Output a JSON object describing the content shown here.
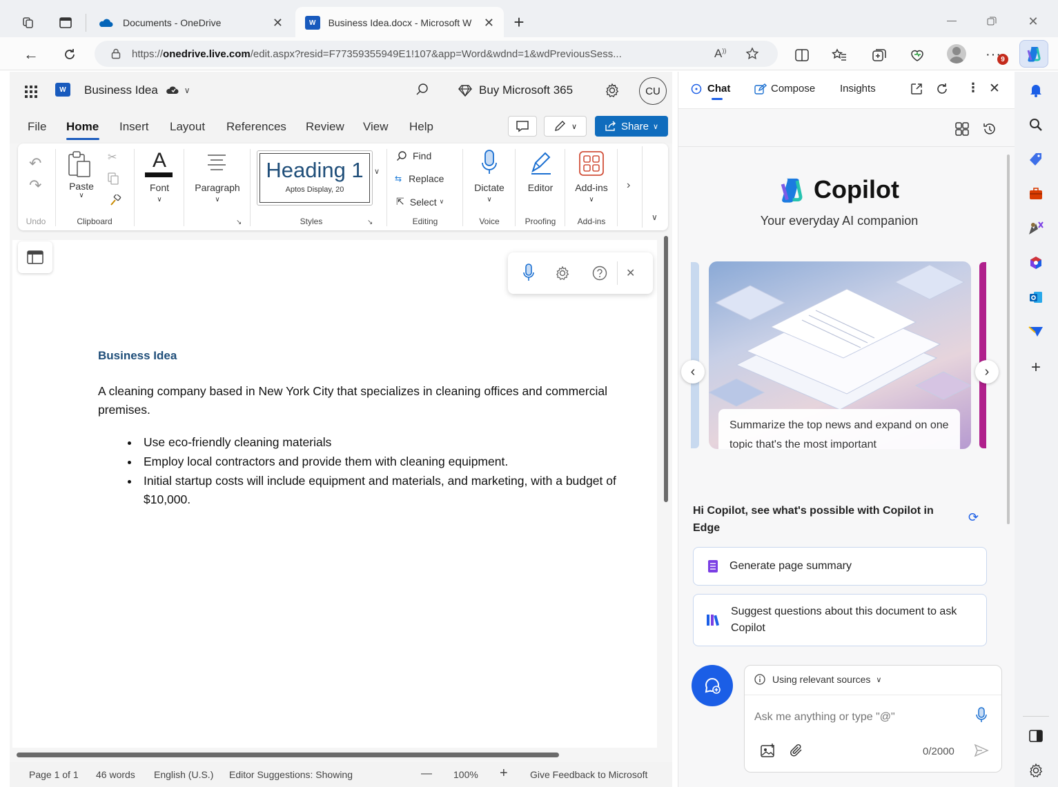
{
  "browser": {
    "tabs": [
      {
        "title": "Documents - OneDrive",
        "active": false
      },
      {
        "title": "Business Idea.docx - Microsoft W",
        "active": true
      }
    ],
    "url_prefix": "https://",
    "url_domain": "onedrive.live.com",
    "url_rest": "/edit.aspx?resid=F77359355949E1!107&app=Word&wdnd=1&wdPreviousSess...",
    "notification_count": "9"
  },
  "word": {
    "doc_name": "Business Idea",
    "buy_label": "Buy Microsoft 365",
    "avatar_initials": "CU",
    "menu": [
      "File",
      "Home",
      "Insert",
      "Layout",
      "References",
      "Review",
      "View",
      "Help"
    ],
    "share_label": "Share",
    "ribbon": {
      "undo_group": "Undo",
      "paste": "Paste",
      "clipboard_group": "Clipboard",
      "font": "Font",
      "paragraph": "Paragraph",
      "style_heading": "Heading 1",
      "style_font": "Aptos Display, 20",
      "styles_group": "Styles",
      "find": "Find",
      "replace": "Replace",
      "select": "Select",
      "editing_group": "Editing",
      "dictate": "Dictate",
      "voice_group": "Voice",
      "editor": "Editor",
      "proofing_group": "Proofing",
      "addins": "Add-ins",
      "addins_group": "Add-ins"
    },
    "document": {
      "heading": "Business Idea",
      "paragraph": "A cleaning company based in New York City that specializes in cleaning offices and commercial premises.",
      "bullets": [
        "Use eco-friendly cleaning materials",
        "Employ local contractors and provide them with cleaning equipment.",
        "Initial startup costs will include equipment and materials, and marketing, with a budget of $10,000."
      ]
    },
    "status": {
      "page": "Page 1 of 1",
      "words": "46 words",
      "language": "English (U.S.)",
      "editor": "Editor Suggestions: Showing",
      "zoom_minus": "—",
      "zoom": "100%",
      "zoom_plus": "+",
      "feedback": "Give Feedback to Microsoft"
    }
  },
  "copilot": {
    "tabs": {
      "chat": "Chat",
      "compose": "Compose",
      "insights": "Insights"
    },
    "brand": "Copilot",
    "tagline": "Your everyday AI companion",
    "card_prompt": "Summarize the top news and expand on one topic that's the most important",
    "greeting": "Hi Copilot, see what's possible with Copilot in Edge",
    "suggestions": [
      "Generate page summary",
      "Suggest questions about this document to ask Copilot"
    ],
    "sources_label": "Using relevant sources",
    "input_placeholder": "Ask me anything or type \"@\"",
    "char_count": "0/2000"
  },
  "colors": {
    "word_blue": "#185abd",
    "share_blue": "#0f6cbd",
    "heading_blue": "#1f4e79",
    "copilot_blue": "#1b5ee6",
    "purple": "#7b3fe4"
  }
}
